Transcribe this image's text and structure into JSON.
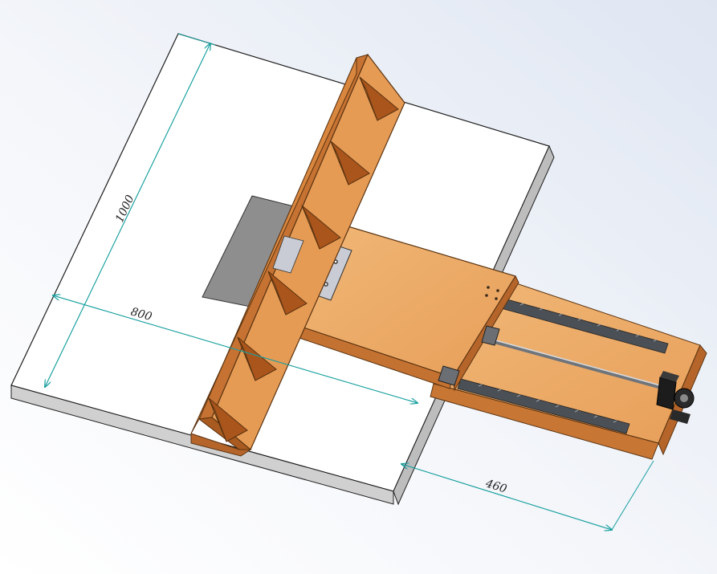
{
  "dimensions": {
    "height_label": "1000",
    "width_label": "800",
    "slide_label": "460"
  },
  "colors": {
    "dimension_line": "#1aa0a0",
    "wood_light": "#eba865",
    "wood_mid": "#d98a46",
    "wood_dark": "#b5652a",
    "table_top": "#ffffff",
    "table_edge": "#c9c9c9",
    "metal_plate": "#c9ccd4",
    "rail": "#555a60"
  },
  "parts": [
    "table-board",
    "fence",
    "fence-gussets",
    "sliding-carriage",
    "guide-rails",
    "lead-screw",
    "stepper-motor",
    "router-plate",
    "insert-plate"
  ]
}
